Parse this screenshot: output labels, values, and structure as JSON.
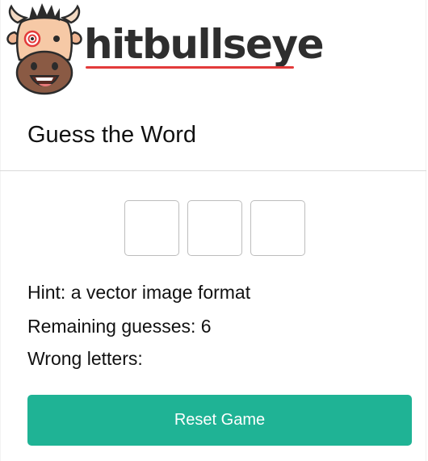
{
  "brand": {
    "wordmark": "hitbullseye",
    "accent_color": "#e33a3a",
    "mascot_icon": "bull-mascot-icon"
  },
  "game": {
    "title": "Guess the Word",
    "letters": [
      "",
      "",
      ""
    ],
    "hint_label": "Hint:",
    "hint_text": "a vector image format",
    "remaining_label": "Remaining guesses:",
    "remaining_count": "6",
    "wrong_label": "Wrong letters:",
    "wrong_letters": ""
  },
  "controls": {
    "reset_label": "Reset Game",
    "reset_color": "#1fb395"
  }
}
